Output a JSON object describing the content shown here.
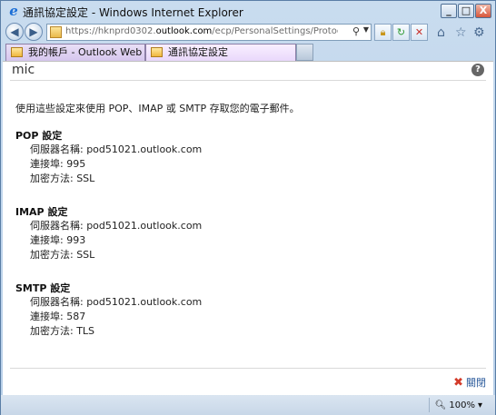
{
  "window": {
    "title": "通訊協定設定 - Windows Internet Explorer",
    "controls": {
      "minimize": "_",
      "maximize": "□",
      "close": "X"
    }
  },
  "address_bar": {
    "url_prefix": "https://hknprd0302.",
    "url_domain": "outlook.com",
    "url_path": "/ecp/PersonalSettings/ProtocolSettings.aspx?"
  },
  "tabs": [
    {
      "label": "我的帳戶 - Outlook Web App"
    },
    {
      "label": "通訊協定設定"
    }
  ],
  "page": {
    "title": "mic",
    "intro": "使用這些設定來使用 POP、IMAP 或 SMTP 存取您的電子郵件。",
    "sections": [
      {
        "title": "POP 設定",
        "server": "伺服器名稱: pod51021.outlook.com",
        "port": "連接埠: 995",
        "encryption": "加密方法: SSL"
      },
      {
        "title": "IMAP 設定",
        "server": "伺服器名稱: pod51021.outlook.com",
        "port": "連接埠: 993",
        "encryption": "加密方法: SSL"
      },
      {
        "title": "SMTP 設定",
        "server": "伺服器名稱: pod51021.outlook.com",
        "port": "連接埠: 587",
        "encryption": "加密方法: TLS"
      }
    ],
    "close_label": "關閉"
  },
  "status_bar": {
    "zoom": "100%"
  }
}
